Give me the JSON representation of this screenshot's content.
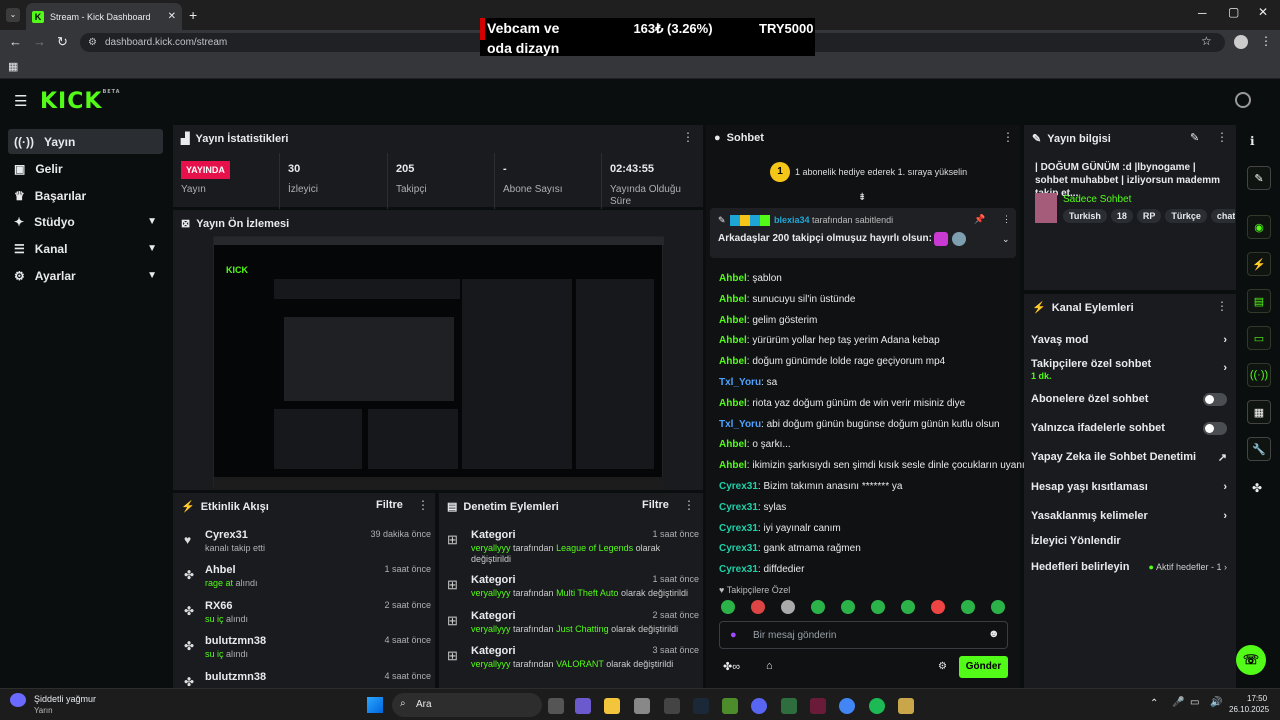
{
  "browser": {
    "tab_title": "Stream - Kick Dashboard",
    "url": "dashboard.kick.com/stream"
  },
  "ticker": {
    "item1": "Vebcam ve oda dizayn",
    "item2": "163₺ (3.26%)",
    "item3": "TRY5000"
  },
  "brand": {
    "logo": "KICK",
    "beta": "BETA",
    "accent": "#53fc18"
  },
  "sidebar": {
    "items": [
      {
        "label": "Yayın",
        "icon": "broadcast-icon"
      },
      {
        "label": "Gelir",
        "icon": "money-icon"
      },
      {
        "label": "Başarılar",
        "icon": "trophy-icon"
      },
      {
        "label": "Stüdyo",
        "icon": "studio-icon"
      },
      {
        "label": "Kanal",
        "icon": "channel-icon"
      },
      {
        "label": "Ayarlar",
        "icon": "gear-icon"
      }
    ]
  },
  "stats": {
    "title": "Yayın İstatistikleri",
    "live_badge": "YAYINDA",
    "live_label": "Yayın",
    "viewers": "30",
    "viewers_label": "İzleyici",
    "followers": "205",
    "followers_label": "Takipçi",
    "subs": "-",
    "subs_label": "Abone Sayısı",
    "uptime": "02:43:55",
    "uptime_label": "Yayında Olduğu Süre"
  },
  "preview": {
    "title": "Yayın Ön İzlemesi"
  },
  "activity": {
    "title": "Etkinlik Akışı",
    "filter": "Filtre",
    "items": [
      {
        "name": "Cyrex31",
        "sub": "kanalı takip etti",
        "time": "39 dakika önce"
      },
      {
        "name": "Ahbel",
        "sub_a": "rage at",
        "sub_b": " alındı",
        "time": "1 saat önce"
      },
      {
        "name": "RX66",
        "sub_a": "su iç",
        "sub_b": " alındı",
        "time": "2 saat önce"
      },
      {
        "name": "bulutzmn38",
        "sub_a": "su iç",
        "sub_b": " alındı",
        "time": "4 saat önce"
      },
      {
        "name": "bulutzmn38",
        "time": "4 saat önce"
      }
    ]
  },
  "modlog": {
    "title": "Denetim Eylemleri",
    "filter": "Filtre",
    "items": [
      {
        "name": "Kategori",
        "user": "veryallyyy",
        "mid": " tarafından ",
        "target": "League of Legends",
        "end": " olarak değiştirildi",
        "time": "1 saat önce"
      },
      {
        "name": "Kategori",
        "user": "veryallyyy",
        "mid": " tarafından ",
        "target": "Multi Theft Auto",
        "end": " olarak değiştirildi",
        "time": "1 saat önce"
      },
      {
        "name": "Kategori",
        "user": "veryallyyy",
        "mid": " tarafından ",
        "target": "Just Chatting",
        "end": " olarak değiştirildi",
        "time": "2 saat önce"
      },
      {
        "name": "Kategori",
        "user": "veryallyyy",
        "mid": " tarafından ",
        "target": "VALORANT",
        "end": " olarak değiştirildi",
        "time": "3 saat önce"
      }
    ]
  },
  "chat": {
    "title": "Sohbet",
    "gift_count": "1",
    "gift_text": "1 abonelik hediye ederek 1. sıraya yükselin",
    "pinned_user": "blexia34",
    "pinned_by": " tarafından sabitlendi",
    "pinned_msg": "Arkadaşlar 200 takipçi olmuşuz hayırlı olsun:",
    "messages": [
      {
        "user": "Ahbel",
        "color": "#53fc18",
        "text": "şablon"
      },
      {
        "user": "Ahbel",
        "color": "#53fc18",
        "text": "sunucuyu sil'in üstünde"
      },
      {
        "user": "Ahbel",
        "color": "#53fc18",
        "text": "gelim gösterim"
      },
      {
        "user": "Ahbel",
        "color": "#53fc18",
        "text": "yürürüm yollar hep taş yerim Adana kebap"
      },
      {
        "user": "Ahbel",
        "color": "#53fc18",
        "text": "doğum günümde lolde rage geçiyorum mp4"
      },
      {
        "user": "Txl_Yoru",
        "color": "#4fa3ff",
        "text": "sa"
      },
      {
        "user": "Ahbel",
        "color": "#53fc18",
        "text": "riota yaz doğum günüm de win verir misiniz diye"
      },
      {
        "user": "Txl_Yoru",
        "color": "#4fa3ff",
        "text": "abi doğum günün bugünse doğum günün kutlu olsun"
      },
      {
        "user": "Ahbel",
        "color": "#53fc18",
        "text": "o şarkı..."
      },
      {
        "user": "Ahbel",
        "color": "#53fc18",
        "text": "ikimizin şarkısıydı sen şimdi kısık sesle dinle çocukların uyanır"
      },
      {
        "user": "Cyrex31",
        "color": "#1fd0a8",
        "text": "Bizim takımın anasını ******* ya"
      },
      {
        "user": "Cyrex31",
        "color": "#1fd0a8",
        "text": "sylas"
      },
      {
        "user": "Cyrex31",
        "color": "#1fd0a8",
        "text": "iyi yayınalr canım"
      },
      {
        "user": "Cyrex31",
        "color": "#1fd0a8",
        "text": "gank atmama rağmen"
      },
      {
        "user": "Cyrex31",
        "color": "#1fd0a8",
        "text": "diffdedier"
      }
    ],
    "followers_only": "Takipçilere Özel",
    "input_placeholder": "Bir mesaj gönderin",
    "send": "Gönder"
  },
  "info": {
    "title": "Yayın bilgisi",
    "stream_title": "| DOĞUM GÜNÜM :d |lbynogame | sohbet muhabbet | izliyorsun mademm takip et...",
    "category": "Sadece Sohbet",
    "tags": [
      "Turkish",
      "18",
      "RP",
      "Türkçe",
      "chat"
    ]
  },
  "actions": {
    "title": "Kanal Eylemleri",
    "slow": "Yavaş mod",
    "followers_only": "Takipçilere özel sohbet",
    "followers_only_sub": "1 dk.",
    "subs_only": "Abonelere özel sohbet",
    "emotes_only": "Yalnızca ifadelerle sohbet",
    "ai": "Yapay Zeka ile Sohbet Denetimi",
    "age": "Hesap yaşı kısıtlaması",
    "banned": "Yasaklanmış kelimeler",
    "raid": "İzleyici Yönlendir",
    "goals": "Hedefleri belirleyin",
    "goals_sub": "Aktif hedefler - 1"
  },
  "taskbar": {
    "weather": "Şiddetli yağmur",
    "weather_sub": "Yarın",
    "search": "Ara",
    "time": "17:50",
    "date": "26.10.2025"
  }
}
